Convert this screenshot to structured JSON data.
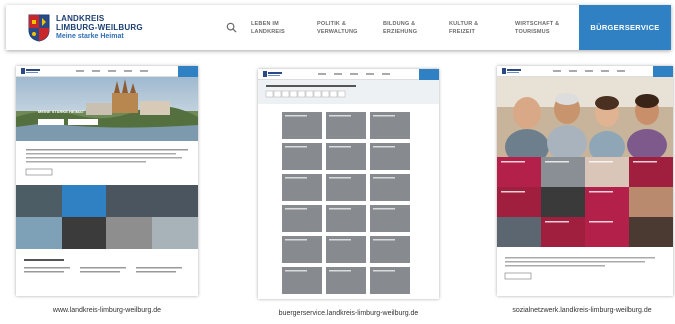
{
  "header": {
    "logo_line1": "LANDKREIS",
    "logo_line2": "LIMBURG-WEILBURG",
    "logo_tagline": "Meine starke Heimat",
    "nav": [
      {
        "line1": "LEBEN IM",
        "line2": "LANDKREIS"
      },
      {
        "line1": "POLITIK &",
        "line2": "VERWALTUNG"
      },
      {
        "line1": "BILDUNG &",
        "line2": "ERZIEHUNG"
      },
      {
        "line1": "KULTUR &",
        "line2": "FREIZEIT"
      },
      {
        "line1": "WIRTSCHAFT &",
        "line2": "TOURISMUS"
      }
    ],
    "cta": "BÜRGERSERVICE"
  },
  "thumbnails": [
    {
      "url": "www.landkreis-limburg-weilburg.de"
    },
    {
      "url": "buergerservice.landkreis-limburg-weilburg.de"
    },
    {
      "url": "sozialnetzwerk.landkreis-limburg-weilburg.de"
    }
  ],
  "colors": {
    "brand_blue": "#2f81c3",
    "navy": "#1b3f73"
  },
  "icons": {
    "search": "search-icon",
    "crest": "coat-of-arms"
  }
}
